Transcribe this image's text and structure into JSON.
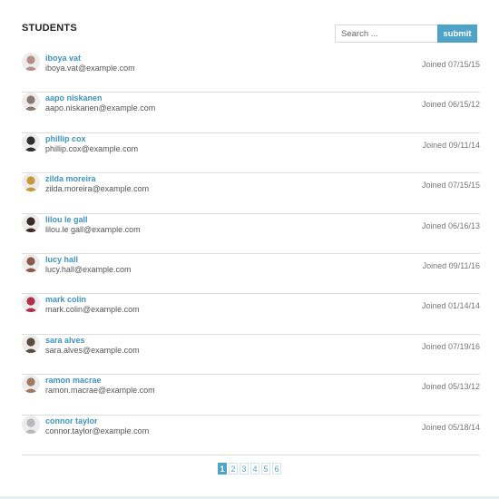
{
  "header": {
    "title": "STUDENTS"
  },
  "search": {
    "placeholder": "Search ...",
    "value": "",
    "submit_label": "submit"
  },
  "students": [
    {
      "name": "iboya vat",
      "email": "iboya.vat@example.com",
      "joined": "Joined 07/15/15",
      "avatar_color": "#b58f86"
    },
    {
      "name": "aapo niskanen",
      "email": "aapo.niskanen@example.com",
      "joined": "Joined 06/15/12",
      "avatar_color": "#8a7a70"
    },
    {
      "name": "phillip cox",
      "email": "phillip.cox@example.com",
      "joined": "Joined 09/11/14",
      "avatar_color": "#2f2f2f"
    },
    {
      "name": "zilda moreira",
      "email": "zilda.moreira@example.com",
      "joined": "Joined 07/15/15",
      "avatar_color": "#c49a3a"
    },
    {
      "name": "lilou le gall",
      "email": "lilou.le gall@example.com",
      "joined": "Joined 06/16/13",
      "avatar_color": "#3b2a26"
    },
    {
      "name": "lucy hall",
      "email": "lucy.hall@example.com",
      "joined": "Joined 09/11/16",
      "avatar_color": "#8c5a4a"
    },
    {
      "name": "mark colin",
      "email": "mark.colin@example.com",
      "joined": "Joined 01/14/14",
      "avatar_color": "#b0324a"
    },
    {
      "name": "sara alves",
      "email": "sara.alves@example.com",
      "joined": "Joined 07/19/16",
      "avatar_color": "#5a4b3c"
    },
    {
      "name": "ramon macrae",
      "email": "ramon.macrae@example.com",
      "joined": "Joined 05/13/12",
      "avatar_color": "#a07a63"
    },
    {
      "name": "connor taylor",
      "email": "connor.taylor@example.com",
      "joined": "Joined 05/18/14",
      "avatar_color": "#b6b8bc"
    }
  ],
  "pagination": {
    "pages": [
      "1",
      "2",
      "3",
      "4",
      "5",
      "6"
    ],
    "active": "1"
  },
  "colors": {
    "accent": "#4ea3c7",
    "name_link": "#3f93bb",
    "divider": "#dcdcdc"
  }
}
